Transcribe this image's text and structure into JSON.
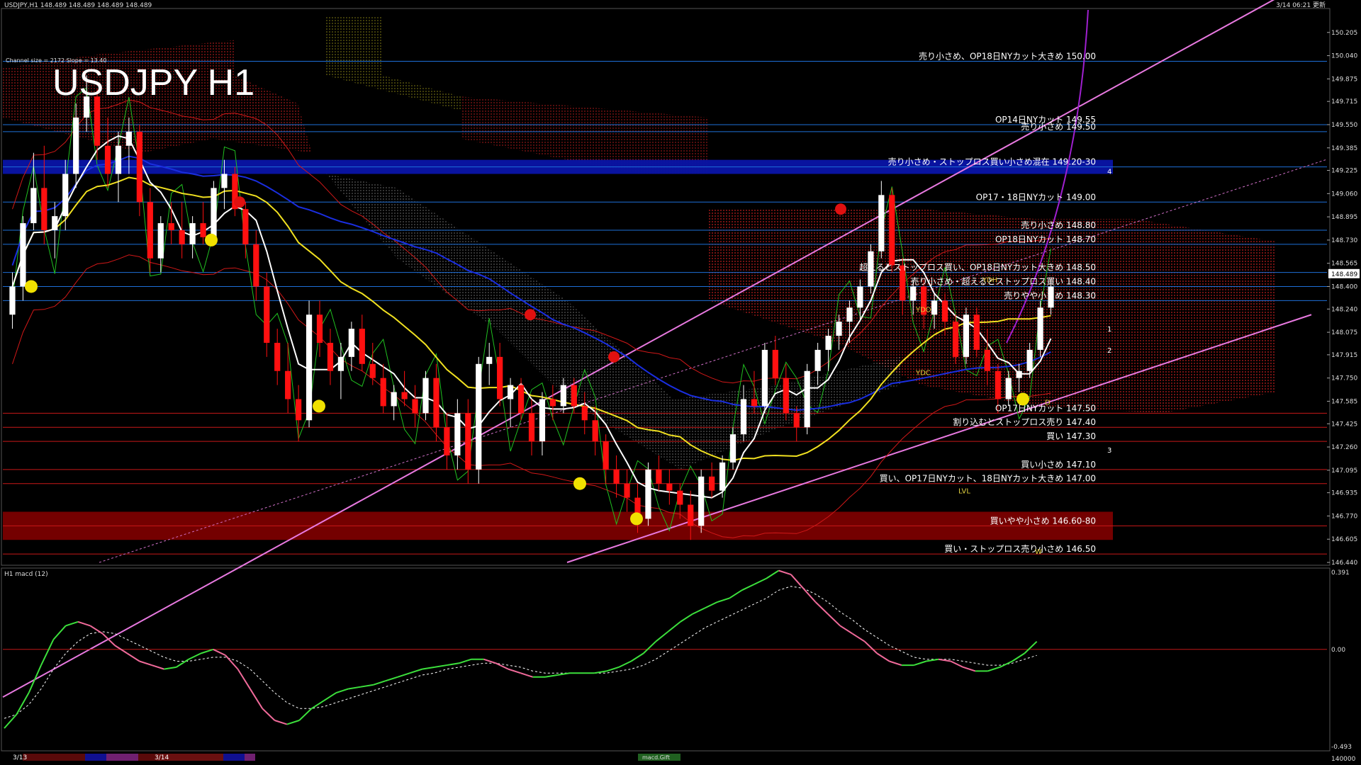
{
  "header": {
    "symbol_info": "USDJPY,H1  148.489 148.489 148.489 148.489",
    "big_title": "USDJPY H1",
    "timestamp": "3/14 06:21 更新",
    "channel_info": "Channel size = 2172  Slope = 13.40"
  },
  "colors": {
    "background": "#000000",
    "bull_candle": "#ffffff",
    "bear_candle": "#ff1010",
    "level_line": "#1e6fd8",
    "red_level_line": "#c81818",
    "channel": "#e879e0",
    "sma_fast": "#ffffff",
    "sma_mid": "#f0e020",
    "sma_slow": "#1a2ee0",
    "kumo": "#e02020",
    "macd_main": "#3ce03c",
    "macd_neg": "#f06a9a",
    "macd_signal": "#ffffff",
    "blue_zone": "#0a14a8",
    "red_zone": "#7a0000"
  },
  "chart_data": {
    "type": "candlestick",
    "symbol": "USDJPY",
    "timeframe": "H1",
    "ylim": [
      146.44,
      150.365
    ],
    "y_ticks": [
      "150.205",
      "150.040",
      "149.875",
      "149.715",
      "149.550",
      "149.385",
      "149.225",
      "149.060",
      "148.895",
      "148.730",
      "148.565",
      "148.400",
      "148.240",
      "148.075",
      "147.915",
      "147.750",
      "147.585",
      "147.425",
      "147.260",
      "147.095",
      "146.935",
      "146.770",
      "146.605",
      "146.440"
    ],
    "current_price": "148.489",
    "candles": [
      [
        148.2,
        148.5,
        148.1,
        148.4
      ],
      [
        148.4,
        148.9,
        148.3,
        148.85
      ],
      [
        148.85,
        149.35,
        148.8,
        149.1
      ],
      [
        149.1,
        149.4,
        148.7,
        148.8
      ],
      [
        148.8,
        149.0,
        148.6,
        148.9
      ],
      [
        148.9,
        149.3,
        148.8,
        149.2
      ],
      [
        149.2,
        149.7,
        149.1,
        149.6
      ],
      [
        149.6,
        149.9,
        149.5,
        149.75
      ],
      [
        149.75,
        149.8,
        149.3,
        149.4
      ],
      [
        149.4,
        149.6,
        149.1,
        149.2
      ],
      [
        149.2,
        149.5,
        149.0,
        149.4
      ],
      [
        149.4,
        149.6,
        149.2,
        149.5
      ],
      [
        149.5,
        149.55,
        148.9,
        149.0
      ],
      [
        149.0,
        149.1,
        148.5,
        148.6
      ],
      [
        148.6,
        148.9,
        148.5,
        148.85
      ],
      [
        148.85,
        149.0,
        148.7,
        148.8
      ],
      [
        148.8,
        149.0,
        148.6,
        148.7
      ],
      [
        148.7,
        148.9,
        148.6,
        148.85
      ],
      [
        148.85,
        149.0,
        148.7,
        148.75
      ],
      [
        148.75,
        149.15,
        148.7,
        149.1
      ],
      [
        149.1,
        149.3,
        148.95,
        149.2
      ],
      [
        149.2,
        149.25,
        148.9,
        148.95
      ],
      [
        148.95,
        149.0,
        148.6,
        148.7
      ],
      [
        148.7,
        148.8,
        148.3,
        148.4
      ],
      [
        148.4,
        148.5,
        147.9,
        148.0
      ],
      [
        148.0,
        148.1,
        147.7,
        147.8
      ],
      [
        147.8,
        148.0,
        147.5,
        147.6
      ],
      [
        147.6,
        147.7,
        147.3,
        147.45
      ],
      [
        147.45,
        148.3,
        147.4,
        148.2
      ],
      [
        148.2,
        148.3,
        147.9,
        148.0
      ],
      [
        148.0,
        148.1,
        147.7,
        147.8
      ],
      [
        147.8,
        148.0,
        147.6,
        147.9
      ],
      [
        147.9,
        148.15,
        147.8,
        148.1
      ],
      [
        148.1,
        148.2,
        147.8,
        147.85
      ],
      [
        147.85,
        148.0,
        147.7,
        147.75
      ],
      [
        147.75,
        147.85,
        147.5,
        147.55
      ],
      [
        147.55,
        147.7,
        147.45,
        147.65
      ],
      [
        147.65,
        147.8,
        147.55,
        147.6
      ],
      [
        147.6,
        147.7,
        147.4,
        147.5
      ],
      [
        147.5,
        147.8,
        147.45,
        147.75
      ],
      [
        147.75,
        147.85,
        147.3,
        147.4
      ],
      [
        147.4,
        147.5,
        147.1,
        147.2
      ],
      [
        147.2,
        147.6,
        147.1,
        147.5
      ],
      [
        147.5,
        147.6,
        147.0,
        147.1
      ],
      [
        147.1,
        147.9,
        147.0,
        147.85
      ],
      [
        147.85,
        148.0,
        147.7,
        147.9
      ],
      [
        147.9,
        148.0,
        147.55,
        147.6
      ],
      [
        147.6,
        147.75,
        147.4,
        147.7
      ],
      [
        147.7,
        147.75,
        147.45,
        147.5
      ],
      [
        147.5,
        147.6,
        147.2,
        147.3
      ],
      [
        147.3,
        147.65,
        147.2,
        147.6
      ],
      [
        147.6,
        147.7,
        147.45,
        147.55
      ],
      [
        147.55,
        147.75,
        147.5,
        147.7
      ],
      [
        147.7,
        147.75,
        147.5,
        147.55
      ],
      [
        147.55,
        147.65,
        147.35,
        147.45
      ],
      [
        147.45,
        147.55,
        147.2,
        147.3
      ],
      [
        147.3,
        147.35,
        147.0,
        147.1
      ],
      [
        147.1,
        147.2,
        146.9,
        147.0
      ],
      [
        147.0,
        147.1,
        146.8,
        146.9
      ],
      [
        146.9,
        147.0,
        146.65,
        146.75
      ],
      [
        146.75,
        147.15,
        146.7,
        147.1
      ],
      [
        147.1,
        147.2,
        146.95,
        147.0
      ],
      [
        147.0,
        147.1,
        146.85,
        146.95
      ],
      [
        146.95,
        147.0,
        146.75,
        146.85
      ],
      [
        146.85,
        146.95,
        146.6,
        146.7
      ],
      [
        146.7,
        147.1,
        146.65,
        147.05
      ],
      [
        147.05,
        147.15,
        146.9,
        146.95
      ],
      [
        146.95,
        147.2,
        146.9,
        147.15
      ],
      [
        147.15,
        147.4,
        147.1,
        147.35
      ],
      [
        147.35,
        147.7,
        147.3,
        147.6
      ],
      [
        147.6,
        147.8,
        147.5,
        147.55
      ],
      [
        147.55,
        148.0,
        147.5,
        147.95
      ],
      [
        147.95,
        148.05,
        147.7,
        147.75
      ],
      [
        147.75,
        147.85,
        147.45,
        147.5
      ],
      [
        147.5,
        147.55,
        147.3,
        147.4
      ],
      [
        147.4,
        147.85,
        147.35,
        147.8
      ],
      [
        147.8,
        148.0,
        147.7,
        147.95
      ],
      [
        147.95,
        148.1,
        147.8,
        148.05
      ],
      [
        148.05,
        148.2,
        147.95,
        148.15
      ],
      [
        148.15,
        148.3,
        148.0,
        148.25
      ],
      [
        148.25,
        148.45,
        148.15,
        148.4
      ],
      [
        148.4,
        148.7,
        148.35,
        148.65
      ],
      [
        148.65,
        149.15,
        148.6,
        149.05
      ],
      [
        149.05,
        149.1,
        148.5,
        148.55
      ],
      [
        148.55,
        148.6,
        148.2,
        148.3
      ],
      [
        148.3,
        148.45,
        148.2,
        148.4
      ],
      [
        148.4,
        148.45,
        148.1,
        148.2
      ],
      [
        148.2,
        148.35,
        148.1,
        148.3
      ],
      [
        148.3,
        148.35,
        148.05,
        148.15
      ],
      [
        148.15,
        148.2,
        147.85,
        147.9
      ],
      [
        147.9,
        148.25,
        147.85,
        148.2
      ],
      [
        148.2,
        148.25,
        147.9,
        147.95
      ],
      [
        147.95,
        148.1,
        147.7,
        147.8
      ],
      [
        147.8,
        147.85,
        147.5,
        147.6
      ],
      [
        147.6,
        147.8,
        147.55,
        147.75
      ],
      [
        147.75,
        147.85,
        147.65,
        147.8
      ],
      [
        147.8,
        148.0,
        147.75,
        147.95
      ],
      [
        147.95,
        148.3,
        147.9,
        148.25
      ],
      [
        148.25,
        148.45,
        148.2,
        148.4
      ]
    ],
    "horizontal_levels": [
      {
        "label": "売り小さめ、OP18日NYカット大きめ 150.00",
        "price": 150.0,
        "color": "blue"
      },
      {
        "label": "OP14日NYカット 149.55",
        "price": 149.55,
        "color": "blue"
      },
      {
        "label": "売り小さめ 149.50",
        "price": 149.5,
        "color": "blue"
      },
      {
        "label": "売り小さめ・ストップロス買い小さめ混在 149.20-30",
        "price": 149.25,
        "color": "blue"
      },
      {
        "label": "OP17・18日NYカット 149.00",
        "price": 149.0,
        "color": "blue"
      },
      {
        "label": "売り小さめ 148.80",
        "price": 148.8,
        "color": "blue"
      },
      {
        "label": "OP18日NYカット 148.70",
        "price": 148.7,
        "color": "blue"
      },
      {
        "label": "超えるとストップロス買い、OP18日NYカット大きめ 148.50",
        "price": 148.5,
        "color": "blue"
      },
      {
        "label": "売り小さめ・超えるとストップロス買い 148.40",
        "price": 148.4,
        "color": "blue"
      },
      {
        "label": "売りやや小さめ 148.30",
        "price": 148.3,
        "color": "blue"
      },
      {
        "label": "OP17日NYカット 147.50",
        "price": 147.5,
        "color": "red"
      },
      {
        "label": "割り込むとストップロス売り 147.40",
        "price": 147.4,
        "color": "red"
      },
      {
        "label": "買い 147.30",
        "price": 147.3,
        "color": "red"
      },
      {
        "label": "買い小さめ 147.10",
        "price": 147.1,
        "color": "red"
      },
      {
        "label": "買い、OP17日NYカット、18日NYカット大きめ 147.00",
        "price": 147.0,
        "color": "red"
      },
      {
        "label": "買いやや小さめ 146.60-80",
        "price": 146.7,
        "color": "red"
      },
      {
        "label": "買い・ストップロス売り小さめ 146.50",
        "price": 146.5,
        "color": "red"
      }
    ],
    "channel": {
      "upper_start": 148.1,
      "upper_end": 150.3,
      "lower_start": 146.2,
      "lower_end": 148.3
    },
    "markers": [
      "YDO",
      "YDC",
      "YDH",
      "LVL",
      "D",
      "W",
      "1",
      "2",
      "3",
      "4"
    ]
  },
  "macd_panel": {
    "title": "H1  macd (12)",
    "y_ticks": [
      "0.391",
      "0.00",
      "-0.493"
    ],
    "ylim": [
      -0.493,
      0.391
    ],
    "main": [
      -0.4,
      -0.33,
      -0.22,
      -0.08,
      0.05,
      0.12,
      0.14,
      0.12,
      0.08,
      0.02,
      -0.02,
      -0.06,
      -0.08,
      -0.1,
      -0.09,
      -0.05,
      -0.02,
      0.0,
      -0.03,
      -0.1,
      -0.2,
      -0.3,
      -0.36,
      -0.38,
      -0.36,
      -0.3,
      -0.26,
      -0.22,
      -0.2,
      -0.19,
      -0.18,
      -0.16,
      -0.14,
      -0.12,
      -0.1,
      -0.09,
      -0.08,
      -0.07,
      -0.05,
      -0.05,
      -0.07,
      -0.1,
      -0.12,
      -0.14,
      -0.14,
      -0.13,
      -0.12,
      -0.12,
      -0.12,
      -0.11,
      -0.09,
      -0.06,
      -0.02,
      0.04,
      0.09,
      0.14,
      0.18,
      0.21,
      0.24,
      0.26,
      0.3,
      0.33,
      0.36,
      0.4,
      0.38,
      0.31,
      0.24,
      0.18,
      0.12,
      0.08,
      0.04,
      -0.02,
      -0.06,
      -0.08,
      -0.08,
      -0.06,
      -0.05,
      -0.06,
      -0.09,
      -0.11,
      -0.11,
      -0.09,
      -0.06,
      -0.02,
      0.04
    ],
    "signal": [
      -0.35,
      -0.33,
      -0.28,
      -0.2,
      -0.1,
      -0.02,
      0.04,
      0.08,
      0.09,
      0.08,
      0.05,
      0.02,
      -0.01,
      -0.04,
      -0.06,
      -0.06,
      -0.05,
      -0.04,
      -0.04,
      -0.06,
      -0.1,
      -0.16,
      -0.22,
      -0.27,
      -0.3,
      -0.3,
      -0.29,
      -0.27,
      -0.25,
      -0.23,
      -0.21,
      -0.19,
      -0.17,
      -0.15,
      -0.13,
      -0.12,
      -0.1,
      -0.09,
      -0.08,
      -0.07,
      -0.07,
      -0.08,
      -0.09,
      -0.11,
      -0.12,
      -0.12,
      -0.12,
      -0.12,
      -0.12,
      -0.12,
      -0.11,
      -0.1,
      -0.08,
      -0.05,
      -0.01,
      0.03,
      0.07,
      0.11,
      0.14,
      0.17,
      0.2,
      0.23,
      0.26,
      0.3,
      0.32,
      0.31,
      0.28,
      0.24,
      0.19,
      0.15,
      0.1,
      0.06,
      0.02,
      -0.01,
      -0.04,
      -0.05,
      -0.05,
      -0.05,
      -0.06,
      -0.07,
      -0.08,
      -0.08,
      -0.07,
      -0.05,
      -0.03
    ],
    "volume_label": "140000",
    "panel_tag": "macd.Gift"
  },
  "period_bar": {
    "labels": [
      "3/13",
      "3/14"
    ]
  },
  "right_price_tag": "148.489"
}
